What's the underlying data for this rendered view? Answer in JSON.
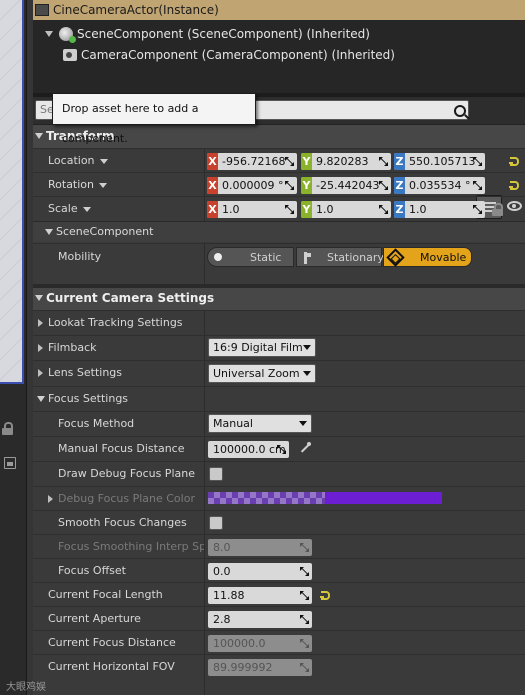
{
  "component_tree": {
    "root": "CineCameraActor(Instance)",
    "scene_component": "SceneComponent (SceneComponent) (Inherited)",
    "camera_component": "CameraComponent (CameraComponent) (Inherited)"
  },
  "search": {
    "placeholder": "Se",
    "tooltip": "Drop asset here to add a component."
  },
  "transform": {
    "header": "Transform",
    "location": {
      "label": "Location",
      "x": "-956.72168",
      "y": "9.820283",
      "z": "550.105713"
    },
    "rotation": {
      "label": "Rotation",
      "x": "0.000009 °",
      "y": "-25.442043",
      "z": "0.035534 °"
    },
    "scale": {
      "label": "Scale",
      "x": "1.0",
      "y": "1.0",
      "z": "1.0"
    },
    "axis_labels": {
      "x": "X",
      "y": "Y",
      "z": "Z"
    }
  },
  "scene_component": {
    "header": "SceneComponent",
    "mobility_label": "Mobility",
    "mobility_options": [
      "Static",
      "Stationary",
      "Movable"
    ],
    "mobility_selected": "Movable"
  },
  "camera_settings": {
    "header": "Current Camera Settings",
    "lookat": "Lookat Tracking Settings",
    "filmback": {
      "label": "Filmback",
      "value": "16:9 Digital Film"
    },
    "lens": {
      "label": "Lens Settings",
      "value": "Universal Zoom"
    },
    "focus_settings": "Focus Settings",
    "focus_method": {
      "label": "Focus Method",
      "value": "Manual"
    },
    "manual_focus_distance": {
      "label": "Manual Focus Distance",
      "value": "100000.0 cm"
    },
    "draw_debug_focus_plane": {
      "label": "Draw Debug Focus Plane",
      "checked": false
    },
    "debug_focus_plane_color": {
      "label": "Debug Focus Plane Color",
      "color": "#6b1ed2"
    },
    "smooth_focus_changes": {
      "label": "Smooth Focus Changes",
      "checked": false
    },
    "focus_smoothing_interp_speed": {
      "label": "Focus Smoothing Interp Spee",
      "value": "8.0"
    },
    "focus_offset": {
      "label": "Focus Offset",
      "value": "0.0"
    },
    "current_focal_length": {
      "label": "Current Focal Length",
      "value": "11.88"
    },
    "current_aperture": {
      "label": "Current Aperture",
      "value": "2.8"
    },
    "current_focus_distance": {
      "label": "Current Focus Distance",
      "value": "100000.0"
    },
    "current_horizontal_fov": {
      "label": "Current Horizontal FOV",
      "value": "89.999992"
    }
  },
  "watermark": "大眼鸡娱",
  "colors": {
    "accent": "#e3a31a",
    "selected_row": "#c0a573",
    "x_axis": "#c8412c",
    "y_axis": "#8ab32b",
    "z_axis": "#3a78c2",
    "reset_arrow": "#d6c63a"
  }
}
